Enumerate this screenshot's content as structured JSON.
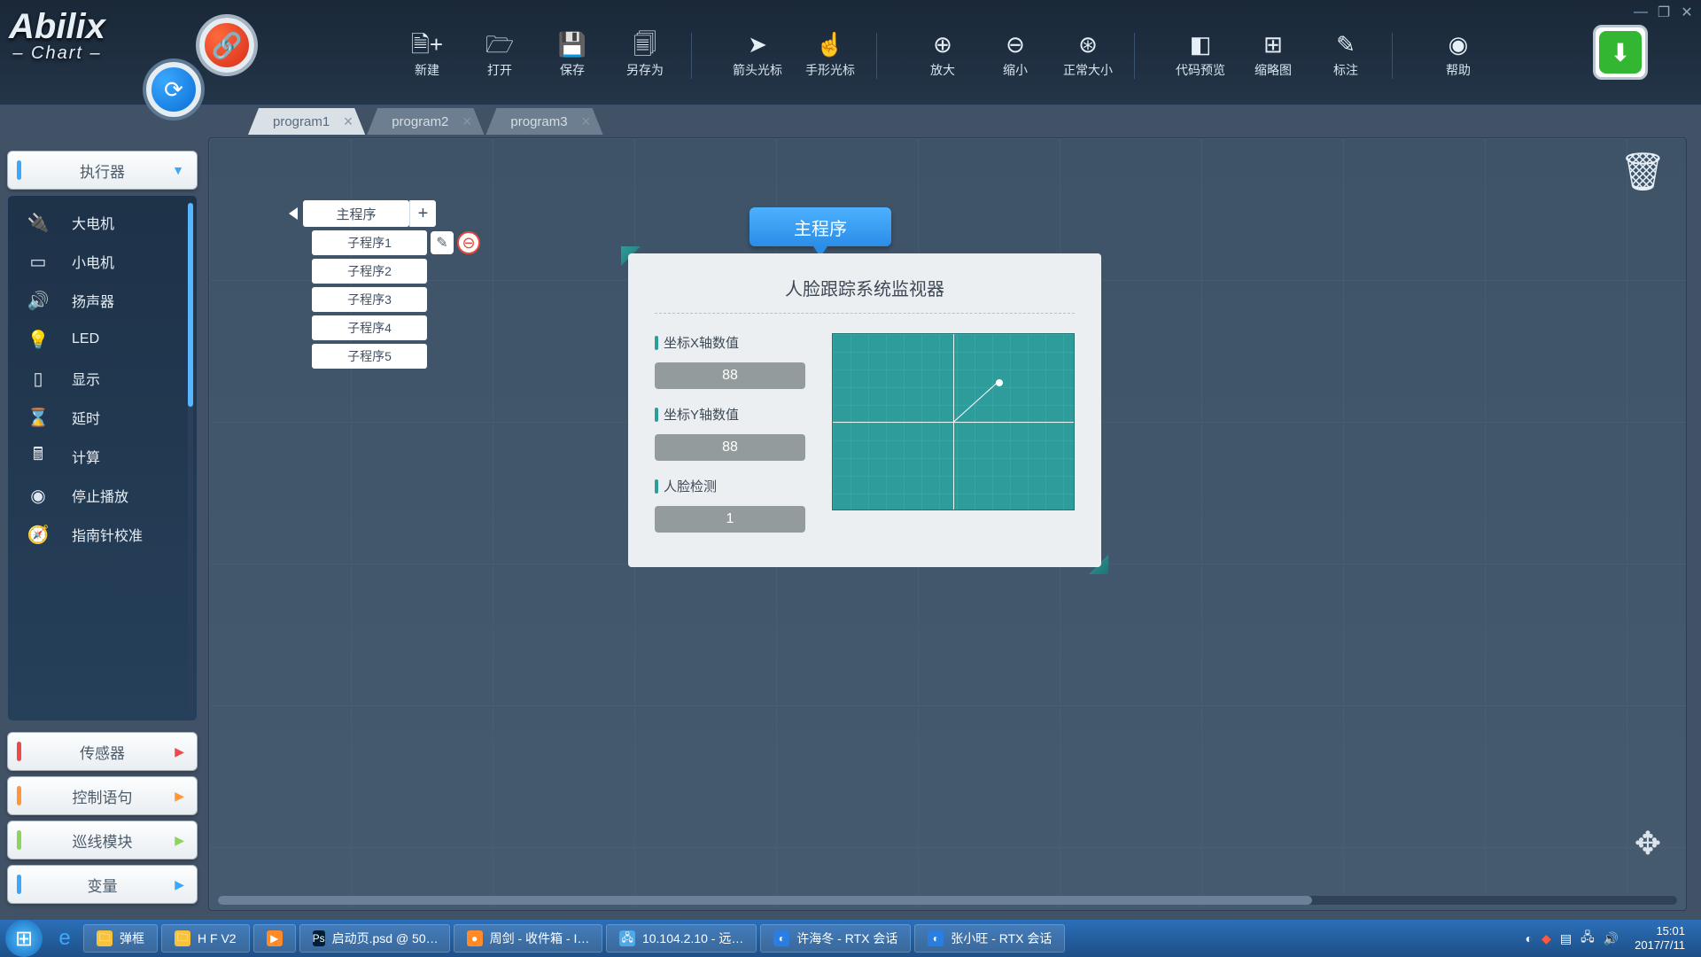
{
  "app": {
    "name": "Abilix",
    "subtitle": "Chart"
  },
  "window_controls": {
    "min": "—",
    "max": "❐",
    "close": "✕"
  },
  "toolbar": {
    "groups": [
      {
        "items": [
          {
            "icon": "🗎+",
            "label": "新建"
          },
          {
            "icon": "🗁",
            "label": "打开"
          },
          {
            "icon": "💾",
            "label": "保存"
          },
          {
            "icon": "🗐",
            "label": "另存为"
          }
        ]
      },
      {
        "items": [
          {
            "icon": "➤",
            "label": "箭头光标"
          },
          {
            "icon": "☝",
            "label": "手形光标"
          }
        ]
      },
      {
        "items": [
          {
            "icon": "⊕",
            "label": "放大"
          },
          {
            "icon": "⊖",
            "label": "缩小"
          },
          {
            "icon": "⊛",
            "label": "正常大小"
          }
        ]
      },
      {
        "items": [
          {
            "icon": "◧",
            "label": "代码预览"
          },
          {
            "icon": "⊞",
            "label": "缩略图"
          },
          {
            "icon": "✎",
            "label": "标注"
          }
        ]
      },
      {
        "items": [
          {
            "icon": "◉",
            "label": "帮助"
          }
        ]
      }
    ]
  },
  "download_btn": "⬇",
  "tabs": [
    {
      "label": "program1",
      "active": true
    },
    {
      "label": "program2",
      "active": false
    },
    {
      "label": "program3",
      "active": false
    }
  ],
  "sidebar": {
    "active_title": "执行器",
    "components": [
      {
        "icon": "🔌",
        "label": "大电机"
      },
      {
        "icon": "▭",
        "label": "小电机"
      },
      {
        "icon": "🔊",
        "label": "扬声器"
      },
      {
        "icon": "💡",
        "label": "LED"
      },
      {
        "icon": "▯",
        "label": "显示"
      },
      {
        "icon": "⌛",
        "label": "延时"
      },
      {
        "icon": "🖩",
        "label": "计算"
      },
      {
        "icon": "◉",
        "label": "停止播放"
      },
      {
        "icon": "🧭",
        "label": "指南针校准"
      }
    ],
    "panels": [
      {
        "title": "传感器",
        "color": "red"
      },
      {
        "title": "控制语句",
        "color": "orange"
      },
      {
        "title": "巡线模块",
        "color": "green"
      },
      {
        "title": "变量",
        "color": "blue"
      }
    ]
  },
  "program_tree": {
    "main": "主程序",
    "subs": [
      "子程序1",
      "子程序2",
      "子程序3",
      "子程序4",
      "子程序5"
    ]
  },
  "canvas_block": "主程序",
  "dialog": {
    "title": "人脸跟踪系统监视器",
    "fields": [
      {
        "label": "坐标X轴数值",
        "value": "88"
      },
      {
        "label": "坐标Y轴数值",
        "value": "88"
      },
      {
        "label": "人脸检测",
        "value": "1"
      }
    ]
  },
  "taskbar": {
    "items": [
      {
        "icon_bg": "#f7c23c",
        "icon": "🗀",
        "label": "弹框"
      },
      {
        "icon_bg": "#f7c23c",
        "icon": "🗀",
        "label": "H F  V2"
      },
      {
        "icon_bg": "#ff8a2a",
        "icon": "▶",
        "label": ""
      },
      {
        "icon_bg": "#001e36",
        "icon": "Ps",
        "label": "启动页.psd @ 50…"
      },
      {
        "icon_bg": "#ff8a2a",
        "icon": "●",
        "label": "周剑 - 收件箱 - I…"
      },
      {
        "icon_bg": "#4fa8e8",
        "icon": "🖧",
        "label": "10.104.2.10 - 远…"
      },
      {
        "icon_bg": "#2a7de1",
        "icon": "◐",
        "label": "许海冬 - RTX 会话"
      },
      {
        "icon_bg": "#2a7de1",
        "icon": "◐",
        "label": "张小旺 - RTX 会话"
      }
    ],
    "clock": {
      "time": "15:01",
      "date": "2017/7/11"
    }
  }
}
